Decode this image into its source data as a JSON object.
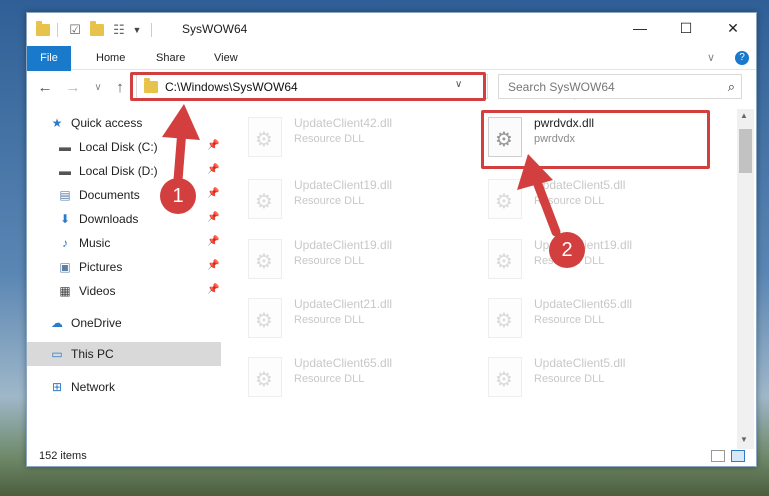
{
  "window": {
    "title": "SysWOW64",
    "minimize_glyph": "—",
    "maximize_glyph": "☐",
    "close_glyph": "✕"
  },
  "ribbon": {
    "tabs": [
      "File",
      "Home",
      "Share",
      "View"
    ],
    "expand_glyph": "∨",
    "help_glyph": "?"
  },
  "nav": {
    "back_glyph": "←",
    "forward_glyph": "→",
    "recent_glyph": "∨",
    "up_glyph": "↑",
    "address": "C:\\Windows\\SysWOW64",
    "address_dropdown_glyph": "∨",
    "refresh_glyph": "↻",
    "search_placeholder": "Search SysWOW64",
    "search_glyph": "⌕"
  },
  "sidebar": {
    "items": [
      {
        "label": "Quick access",
        "icon": "star-icon",
        "glyph": "★",
        "color": "#2f79c9"
      },
      {
        "label": "Local Disk (C:)",
        "icon": "drive-icon",
        "glyph": "▬",
        "color": "#555555"
      },
      {
        "label": "Local Disk (D:)",
        "icon": "drive-icon",
        "glyph": "▬",
        "color": "#555555"
      },
      {
        "label": "Documents",
        "icon": "documents-icon",
        "glyph": "▤",
        "color": "#5d7fa6"
      },
      {
        "label": "Downloads",
        "icon": "download-icon",
        "glyph": "⬇",
        "color": "#2f79c9"
      },
      {
        "label": "Music",
        "icon": "music-icon",
        "glyph": "♪",
        "color": "#2f79c9"
      },
      {
        "label": "Pictures",
        "icon": "pictures-icon",
        "glyph": "▣",
        "color": "#5d7fa6"
      },
      {
        "label": "Videos",
        "icon": "videos-icon",
        "glyph": "▦",
        "color": "#444444"
      },
      {
        "label": "OneDrive",
        "icon": "cloud-icon",
        "glyph": "☁",
        "color": "#2f79c9"
      },
      {
        "label": "This PC",
        "icon": "computer-icon",
        "glyph": "▭",
        "color": "#2f79c9"
      },
      {
        "label": "Network",
        "icon": "network-icon",
        "glyph": "⊞",
        "color": "#2f79c9"
      }
    ],
    "pin_glyph": "📌"
  },
  "files": [
    {
      "name": "UpdateClient42.dll",
      "desc": "Resource DLL"
    },
    {
      "name": "pwrdvdx.dll",
      "desc": "pwrdvdx"
    },
    {
      "name": "UpdateClient19.dll",
      "desc": "Resource DLL"
    },
    {
      "name": "UpdateClient5.dll",
      "desc": "Resource DLL"
    },
    {
      "name": "UpdateClient19.dll",
      "desc": "Resource DLL"
    },
    {
      "name": "UpdateClient19.dll",
      "desc": "Resource DLL"
    },
    {
      "name": "UpdateClient21.dll",
      "desc": "Resource DLL"
    },
    {
      "name": "UpdateClient65.dll",
      "desc": "Resource DLL"
    },
    {
      "name": "UpdateClient65.dll",
      "desc": "Resource DLL"
    },
    {
      "name": "UpdateClient5.dll",
      "desc": "Resource DLL"
    }
  ],
  "status": {
    "items_count": "152 items"
  },
  "annotations": {
    "step1": "1",
    "step2": "2",
    "color": "#d33e3e"
  },
  "scroll": {
    "up_glyph": "▲",
    "down_glyph": "▼"
  }
}
